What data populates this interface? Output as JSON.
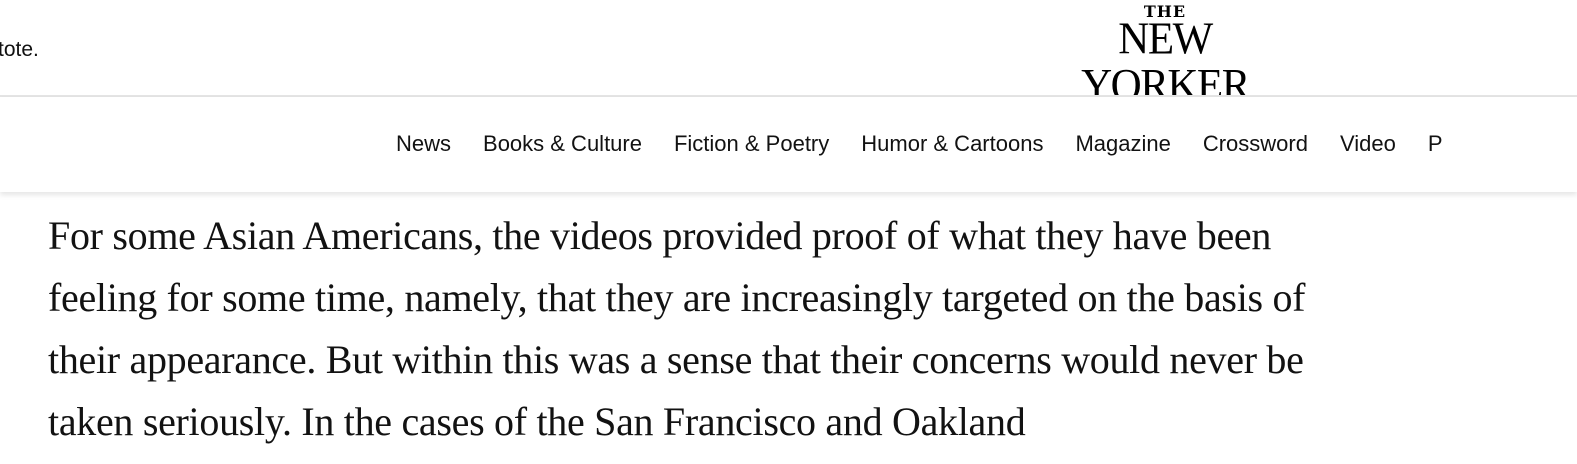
{
  "header": {
    "promo_text": "tote.",
    "logo_top": "THE",
    "logo_main": "NEW YORKER"
  },
  "nav": {
    "items": [
      {
        "label": "News"
      },
      {
        "label": "Books & Culture"
      },
      {
        "label": "Fiction & Poetry"
      },
      {
        "label": "Humor & Cartoons"
      },
      {
        "label": "Magazine"
      },
      {
        "label": "Crossword"
      },
      {
        "label": "Video"
      },
      {
        "label": "P"
      }
    ]
  },
  "article": {
    "paragraph": "For some Asian Americans, the videos provided proof of what they have been feeling for some time, namely, that they are increasingly targeted on the basis of their appearance. But within this was a sense that their concerns would never be taken seriously. In the cases of the San Francisco and Oakland"
  },
  "colors": {
    "text": "#121212",
    "background": "#ffffff",
    "divider": "#e4e4e4"
  }
}
